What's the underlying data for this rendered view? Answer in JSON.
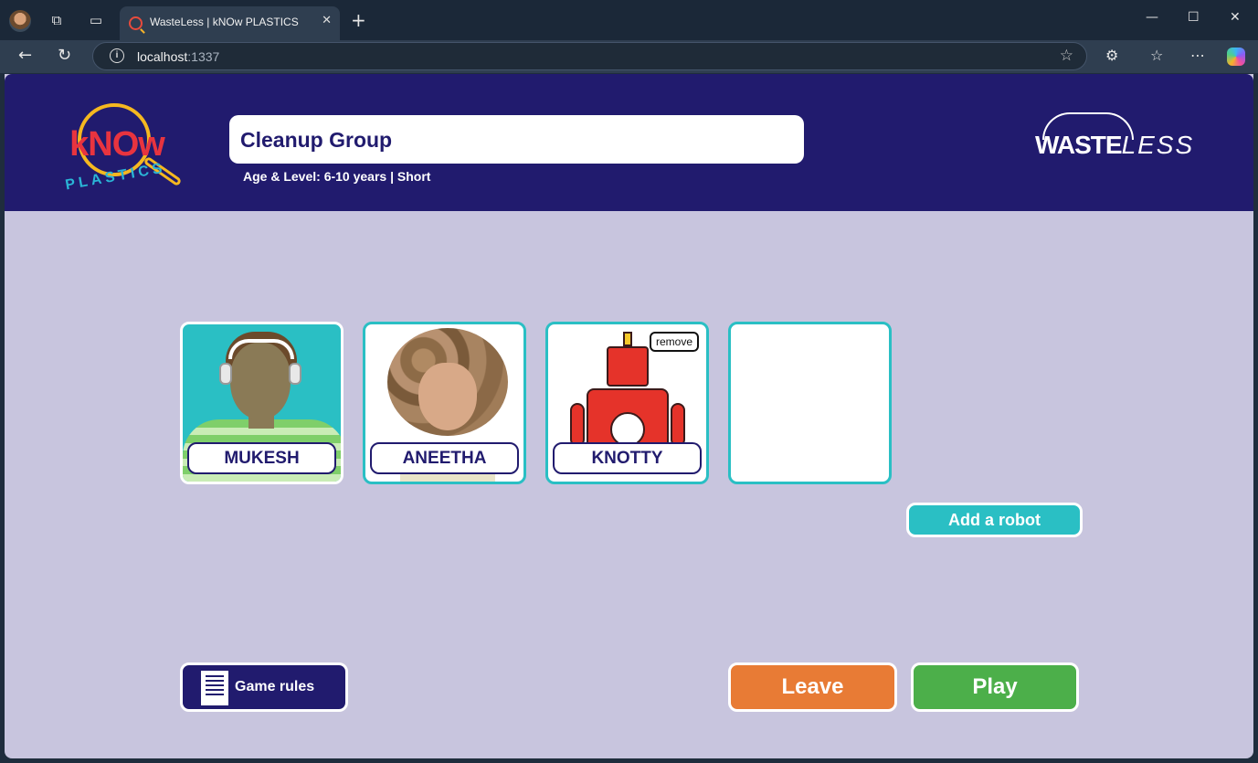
{
  "browser": {
    "tab_title": "WasteLess | kNOw PLASTICS",
    "url_host": "localhost",
    "url_port": ":1337"
  },
  "header": {
    "know_logo_word": "kNOw",
    "know_logo_sub": "PLASTICS",
    "group_name": "Cleanup Group",
    "age_level": "Age & Level: 6-10 years | Short",
    "wasteless_logo_a": "WASTE",
    "wasteless_logo_b": "LESS"
  },
  "players": [
    {
      "name": "MUKESH",
      "avatar": "boy-with-headphones"
    },
    {
      "name": "ANEETHA",
      "avatar": "girl-with-curly-hair"
    },
    {
      "name": "KNOTTY",
      "avatar": "red-robot",
      "remove_label": "remove"
    },
    {
      "name": "",
      "avatar": "empty-slot"
    }
  ],
  "actions": {
    "add_robot": "Add a robot",
    "game_rules": "Game rules",
    "leave": "Leave",
    "play": "Play"
  },
  "colors": {
    "header_bg": "#211b6e",
    "page_bg": "#c8c5de",
    "teal": "#2abfc4",
    "leave": "#e87b35",
    "play": "#4caf4a"
  }
}
